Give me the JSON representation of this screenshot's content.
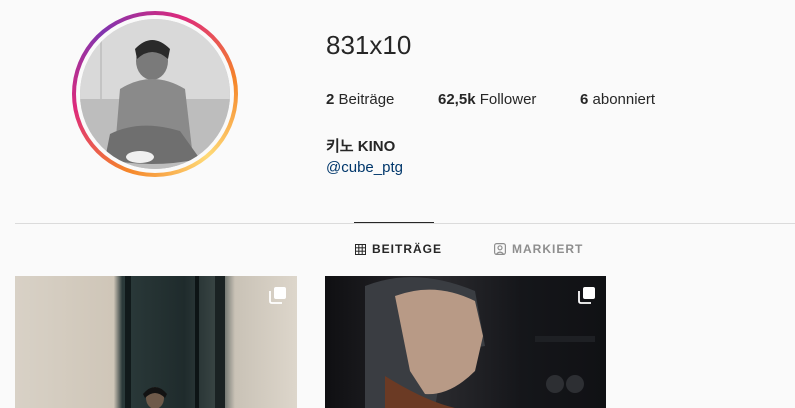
{
  "profile": {
    "username": "831x10",
    "full_name": "키노 KINO",
    "handle": "@cube_ptg",
    "avatar_alt": "profile-photo"
  },
  "stats": {
    "posts_count": "2",
    "posts_label": "Beiträge",
    "followers_count": "62,5k",
    "followers_label": "Follower",
    "following_count": "6",
    "following_label": "abonniert"
  },
  "tabs": {
    "posts": "BEITRÄGE",
    "tagged": "MARKIERT"
  },
  "colors": {
    "background": "#fafafa",
    "text": "#262626",
    "link": "#00376b",
    "muted": "#8e8e8e",
    "divider": "#dbdbdb"
  },
  "posts": [
    {
      "icon": "multiple-images-icon"
    },
    {
      "icon": "multiple-images-icon"
    }
  ]
}
